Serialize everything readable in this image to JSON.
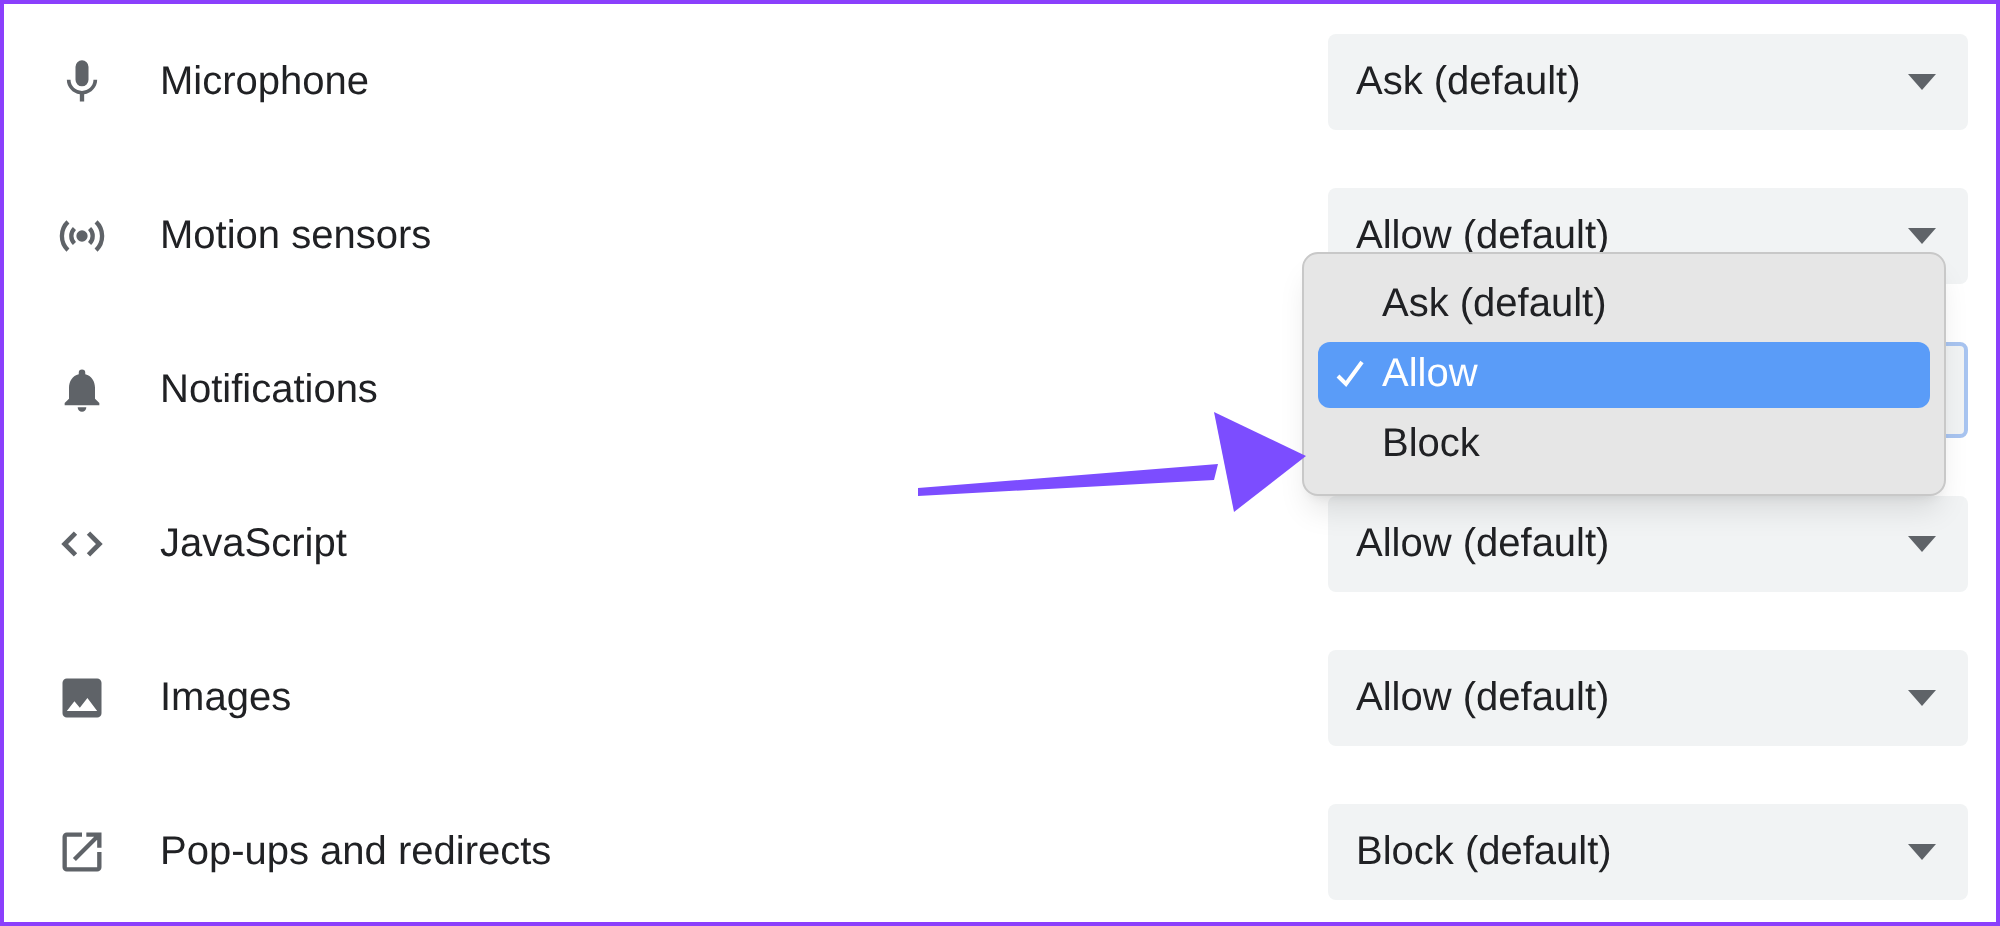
{
  "settings": [
    {
      "label": "Microphone",
      "value": "Ask (default)"
    },
    {
      "label": "Motion sensors",
      "value": "Allow (default)"
    },
    {
      "label": "Notifications",
      "focused": true
    },
    {
      "label": "JavaScript",
      "value": "Allow (default)"
    },
    {
      "label": "Images",
      "value": "Allow (default)"
    },
    {
      "label": "Pop-ups and redirects",
      "value": "Block (default)"
    }
  ],
  "open_menu": {
    "options": [
      {
        "label": "Ask (default)",
        "selected": false
      },
      {
        "label": "Allow",
        "selected": true
      },
      {
        "label": "Block",
        "selected": false
      }
    ]
  }
}
